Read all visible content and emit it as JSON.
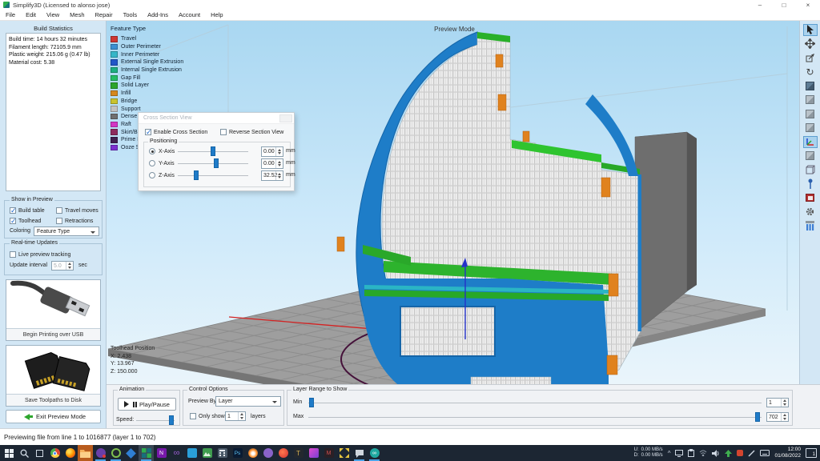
{
  "window": {
    "title": "Simplify3D (Licensed to alonso jose)",
    "min": "–",
    "max": "□",
    "close": "×"
  },
  "menu": {
    "items": [
      "File",
      "Edit",
      "View",
      "Mesh",
      "Repair",
      "Tools",
      "Add-Ins",
      "Account",
      "Help"
    ]
  },
  "left": {
    "build_stats": {
      "title": "Build Statistics",
      "lines": [
        "Build time: 14 hours 32 minutes",
        "Filament length: 72105.9 mm",
        "Plastic weight: 215.06 g (0.47 lb)",
        "Material cost: 5.38"
      ]
    },
    "show": {
      "title": "Show in Preview",
      "build_table": "Build table",
      "travel_moves": "Travel moves",
      "toolhead": "Toolhead",
      "retractions": "Retractions",
      "coloring_label": "Coloring",
      "coloring_value": "Feature Type"
    },
    "rt": {
      "title": "Real-time Updates",
      "live": "Live preview tracking",
      "interval_label": "Update interval",
      "interval_value": "5.0",
      "interval_unit": "sec"
    },
    "usb_label": "Begin Printing over USB",
    "disk_label": "Save Toolpaths to Disk",
    "exit_label": "Exit Preview Mode"
  },
  "viewport": {
    "mode_label": "Preview Mode",
    "legend": {
      "title": "Feature Type",
      "items": [
        {
          "label": "Travel",
          "color": "#cd3632"
        },
        {
          "label": "Outer Perimeter",
          "color": "#3a8fd2"
        },
        {
          "label": "Inner Perimeter",
          "color": "#36b6c8"
        },
        {
          "label": "External Single Extrusion",
          "color": "#2257c8"
        },
        {
          "label": "Internal Single Extrusion",
          "color": "#1daf82"
        },
        {
          "label": "Gap Fill",
          "color": "#25bd66"
        },
        {
          "label": "Solid Layer",
          "color": "#2ca42c"
        },
        {
          "label": "Infill",
          "color": "#d4881e"
        },
        {
          "label": "Bridge",
          "color": "#c9c32e"
        },
        {
          "label": "Support",
          "color": "#c2c2c2"
        },
        {
          "label": "Dense Support",
          "color": "#6f6f6f"
        },
        {
          "label": "Raft",
          "color": "#d335c4"
        },
        {
          "label": "Skirt/Brim",
          "color": "#8d2b5e"
        },
        {
          "label": "Prime Pillar",
          "color": "#3f2050"
        },
        {
          "label": "Ooze Shield",
          "color": "#7b2fd0"
        }
      ]
    },
    "toolhead": {
      "title": "Toolhead Position",
      "x": "X: 2.438",
      "y": "Y: 13.967",
      "z": "Z: 150.000"
    }
  },
  "dialog": {
    "title": "Cross Section View",
    "enable": "Enable Cross Section",
    "reverse": "Reverse Section View",
    "positioning": "Positioning",
    "axes": [
      {
        "label": "X-Axis",
        "value": "0.00",
        "unit": "mm"
      },
      {
        "label": "Y-Axis",
        "value": "0.00",
        "unit": "mm"
      },
      {
        "label": "Z-Axis",
        "value": "32.52",
        "unit": "mm"
      }
    ]
  },
  "bottom": {
    "animation": {
      "title": "Animation",
      "play": "Play/Pause",
      "speed": "Speed:"
    },
    "control": {
      "title": "Control Options",
      "preview_by": "Preview By",
      "preview_value": "Layer",
      "only_show": "Only show",
      "only_value": "1",
      "layers": "layers"
    },
    "range": {
      "title": "Layer Range to Show",
      "min_label": "Min",
      "min_value": "1",
      "max_label": "Max",
      "max_value": "702"
    }
  },
  "status": {
    "text": "Previewing file from line 1 to 1016877 (layer 1 to 702)"
  },
  "taskbar": {
    "icons": [
      "start",
      "search",
      "task-view",
      "chrome",
      "firefox",
      "file-explorer",
      "media-app",
      "camera-app",
      "diamond-app",
      "simplify3d",
      "onenote",
      "visual-studio",
      "vscode",
      "photos",
      "calculator",
      "photoshop",
      "blender",
      "github",
      "red-app",
      "game-app",
      "pink-app",
      "m-app",
      "yellow-arrows-app",
      "chat-app",
      "arduino"
    ],
    "onenote_letter": "N",
    "ps_letter": "Ps",
    "m_letter": "M",
    "vs_glyph": "∞",
    "arduino_glyph": "∞",
    "tray": {
      "u_label": "U:",
      "d_label": "D:",
      "u_val": "0.00 MB/s",
      "d_val": "0.00 MB/s",
      "caret": "^",
      "time": "12:00",
      "date": "01/08/2022",
      "badge": "1"
    }
  }
}
